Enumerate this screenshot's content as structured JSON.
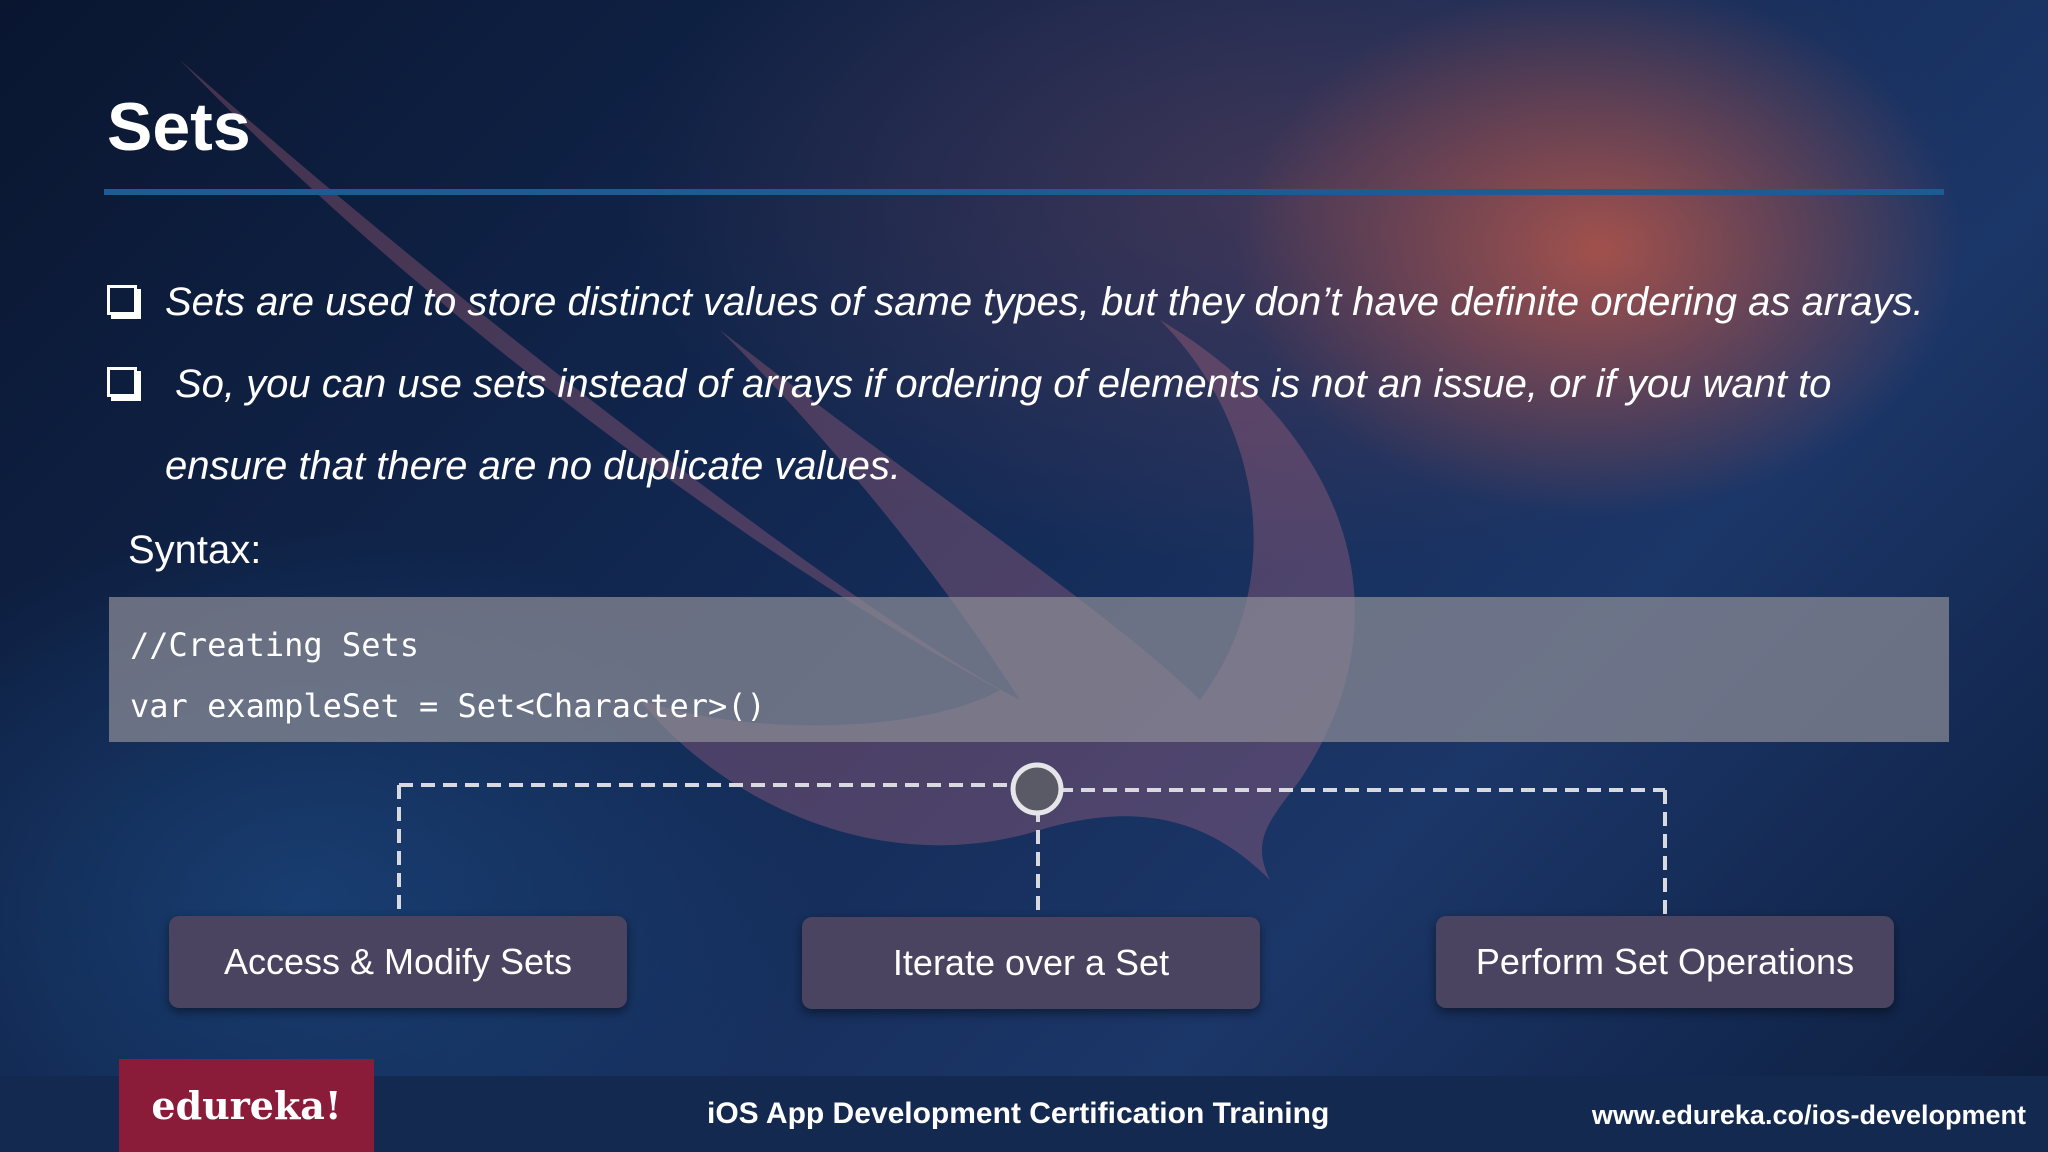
{
  "slide": {
    "title": "Sets",
    "bullets": [
      "Sets are used to store distinct values of same types, but they don’t have definite ordering as arrays.",
      "So, you can use sets instead of arrays if ordering of elements is not an issue, or if you want to",
      "ensure that there are no duplicate values."
    ],
    "syntax_label": "Syntax:",
    "code_lines": [
      "//Creating Sets",
      "var exampleSet = Set<Character>()"
    ],
    "nodes": [
      "Access & Modify Sets",
      "Iterate over a Set",
      "Perform Set Operations"
    ]
  },
  "footer": {
    "logo_text": "edureka!",
    "course": "iOS App Development Certification Training",
    "url": "www.edureka.co/ios-development"
  },
  "icons": {
    "background_logo": "swift-bird-icon",
    "bullet": "checkbox-icon"
  },
  "colors": {
    "title_rule": "#1d5b92",
    "node_bg": "#4a4460",
    "logo_bg": "#8a1c3a",
    "footer_bg": "#13294f"
  }
}
